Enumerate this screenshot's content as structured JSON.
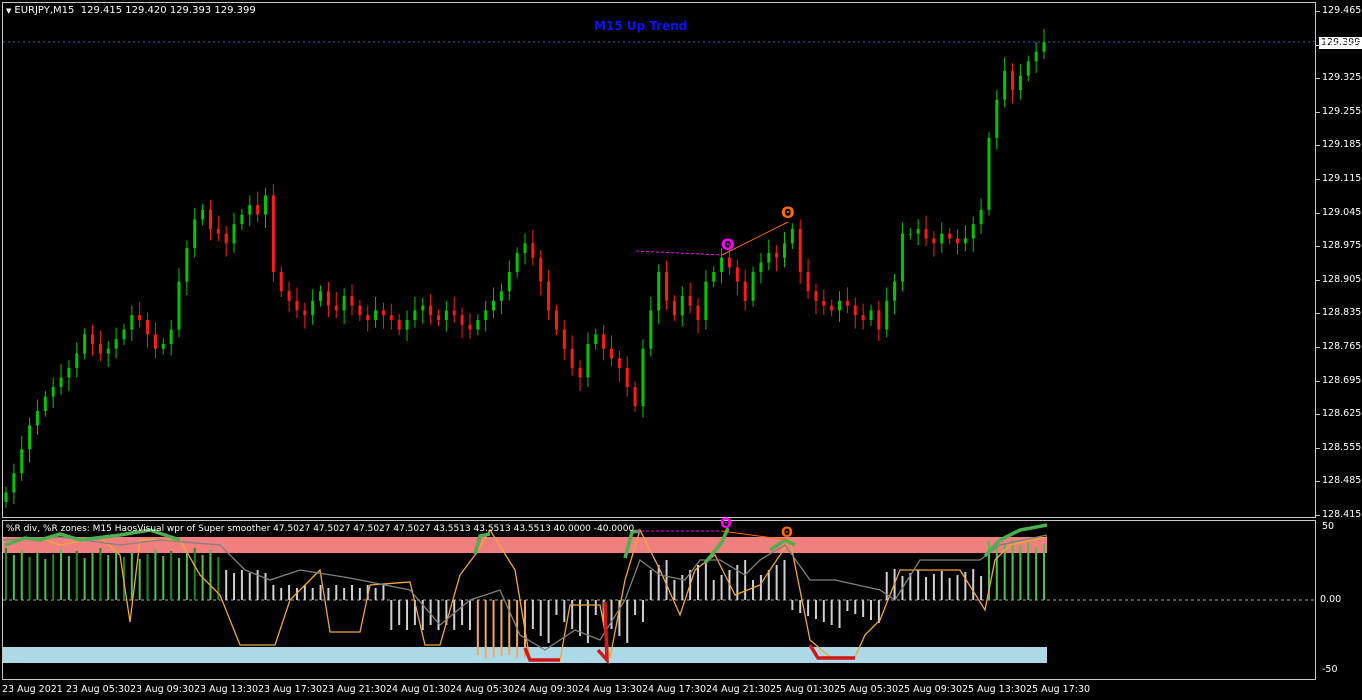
{
  "chart": {
    "symbol_header": "EURJPY,M15",
    "ohlc": "129.415 129.420 129.393 129.399",
    "trend_label": "M15 Up Trend",
    "current_price": "129.399",
    "price_axis": [
      "129.465",
      "129.395",
      "129.325",
      "129.255",
      "129.185",
      "129.115",
      "129.045",
      "128.975",
      "128.905",
      "128.835",
      "128.765",
      "128.695",
      "128.625",
      "128.555",
      "128.485",
      "128.415"
    ],
    "time_axis": [
      "23 Aug 2021",
      "23 Aug 05:30",
      "23 Aug 09:30",
      "23 Aug 13:30",
      "23 Aug 17:30",
      "23 Aug 21:30",
      "24 Aug 01:30",
      "24 Aug 05:30",
      "24 Aug 09:30",
      "24 Aug 13:30",
      "24 Aug 17:30",
      "24 Aug 21:30",
      "25 Aug 01:30",
      "25 Aug 05:30",
      "25 Aug 09:30",
      "25 Aug 13:30",
      "25 Aug 17:30"
    ],
    "colors": {
      "bull": "#00c800",
      "bear": "#ff1a1a",
      "trend": "#0a12ff",
      "upper_zone": "#f08080",
      "lower_zone": "#add8e6",
      "gold_line": "#f0a830",
      "grey_line": "#808080",
      "green_line": "#4caf50",
      "magenta": "#ff00ff",
      "orange": "#ff6a00"
    }
  },
  "indicator": {
    "header": "%R div, %R zones: M15 HaosVisual wpr of Super smoother 47.5027 47.5027 47.5027 47.5027 43.5513 43.5513 43.5513 40.0000 -40.0000",
    "axis": [
      "50",
      "0.00",
      "-50"
    ]
  },
  "chart_data": {
    "type": "candlestick",
    "symbol": "EURJPY",
    "timeframe": "M15",
    "ylim": [
      128.415,
      129.465
    ],
    "last": {
      "open": 129.415,
      "high": 129.42,
      "low": 129.393,
      "close": 129.399
    },
    "closes": [
      128.46,
      128.5,
      128.55,
      128.6,
      128.63,
      128.66,
      128.68,
      128.7,
      128.72,
      128.75,
      128.79,
      128.77,
      128.75,
      128.76,
      128.78,
      128.8,
      128.83,
      128.82,
      128.79,
      128.76,
      128.77,
      128.8,
      128.9,
      128.97,
      129.03,
      129.05,
      129.01,
      129.0,
      128.98,
      129.02,
      129.04,
      129.06,
      129.04,
      129.08,
      128.92,
      128.88,
      128.86,
      128.84,
      128.83,
      128.86,
      128.88,
      128.85,
      128.84,
      128.87,
      128.85,
      128.83,
      128.82,
      128.84,
      128.83,
      128.82,
      128.8,
      128.82,
      128.84,
      128.85,
      128.83,
      128.82,
      128.84,
      128.83,
      128.81,
      128.8,
      128.82,
      128.84,
      128.86,
      128.88,
      128.92,
      128.96,
      128.98,
      128.95,
      128.9,
      128.84,
      128.8,
      128.76,
      128.72,
      128.7,
      128.77,
      128.79,
      128.76,
      128.74,
      128.72,
      128.68,
      128.64,
      128.76,
      128.84,
      128.92,
      128.86,
      128.83,
      128.87,
      128.85,
      128.82,
      128.9,
      128.92,
      128.95,
      128.93,
      128.9,
      128.86,
      128.92,
      128.94,
      128.96,
      128.95,
      128.98,
      129.01,
      128.92,
      128.88,
      128.86,
      128.85,
      128.84,
      128.86,
      128.85,
      128.83,
      128.82,
      128.84,
      128.8,
      128.86,
      128.9,
      129.0,
      129.0,
      129.01,
      128.99,
      128.98,
      129.0,
      128.99,
      128.98,
      128.99,
      129.02,
      129.05,
      129.2,
      129.28,
      129.34,
      129.3,
      129.33,
      129.36,
      129.38,
      129.4
    ]
  }
}
